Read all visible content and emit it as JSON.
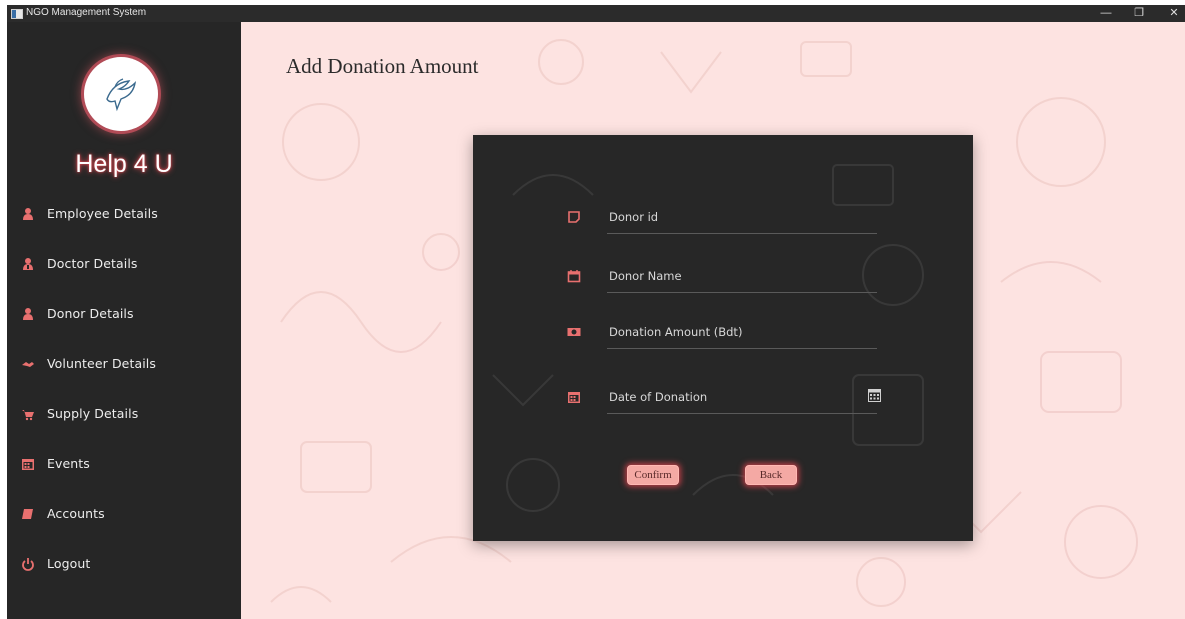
{
  "window": {
    "title": "NGO Management System"
  },
  "sidebar": {
    "brand": "Help 4 U",
    "items": [
      {
        "label": "Employee Details",
        "icon": "user-icon"
      },
      {
        "label": "Doctor Details",
        "icon": "doctor-icon"
      },
      {
        "label": "Donor Details",
        "icon": "user-icon"
      },
      {
        "label": "Volunteer Details",
        "icon": "handshake-icon"
      },
      {
        "label": "Supply Details",
        "icon": "cart-icon"
      },
      {
        "label": "Events",
        "icon": "calendar-icon"
      },
      {
        "label": "Accounts",
        "icon": "book-icon"
      },
      {
        "label": "Logout",
        "icon": "power-icon"
      }
    ]
  },
  "main": {
    "title": "Add Donation Amount"
  },
  "form": {
    "donor_id_placeholder": "Donor id",
    "donor_name_placeholder": "Donor Name",
    "amount_placeholder": "Donation Amount (Bdt)",
    "date_placeholder": "Date of Donation",
    "confirm_label": "Confirm",
    "back_label": "Back"
  },
  "colors": {
    "accent": "#e8706f",
    "sidebar_bg": "#262626",
    "content_bg": "#fde3e1",
    "card_bg": "#272727",
    "button_bg": "#f4a9a4"
  }
}
